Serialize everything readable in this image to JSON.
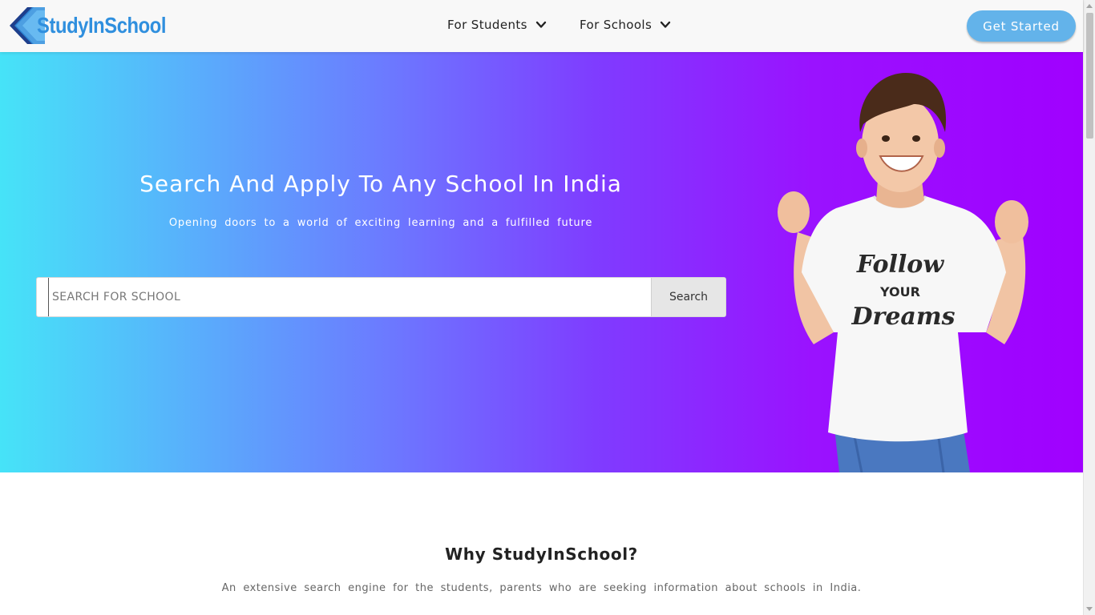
{
  "header": {
    "logo_text": "StudyInSchool",
    "nav": [
      {
        "label": "For Students"
      },
      {
        "label": "For Schools"
      }
    ],
    "cta_label": "Get Started"
  },
  "hero": {
    "title": "Search And Apply To Any School In India",
    "subtitle": "Opening doors to a world of exciting learning and a fulfilled future",
    "search": {
      "placeholder": "SEARCH FOR SCHOOL",
      "value": "",
      "button_label": "Search"
    },
    "illustration": {
      "description_icon": "boy-celebrating-icon",
      "shirt_text": [
        "Follow",
        "YOUR",
        "Dreams"
      ]
    }
  },
  "why": {
    "title": "Why StudyInSchool?",
    "text": "An extensive search engine for the students, parents who are seeking information about schools in India."
  },
  "colors": {
    "brand_blue": "#2f8fde",
    "cta": "#63b3ea",
    "hero_start": "#46e3f8",
    "hero_end": "#a000ff"
  },
  "icons": {
    "logo": "chevron-logo-icon",
    "dropdown": "chevron-down-icon"
  }
}
